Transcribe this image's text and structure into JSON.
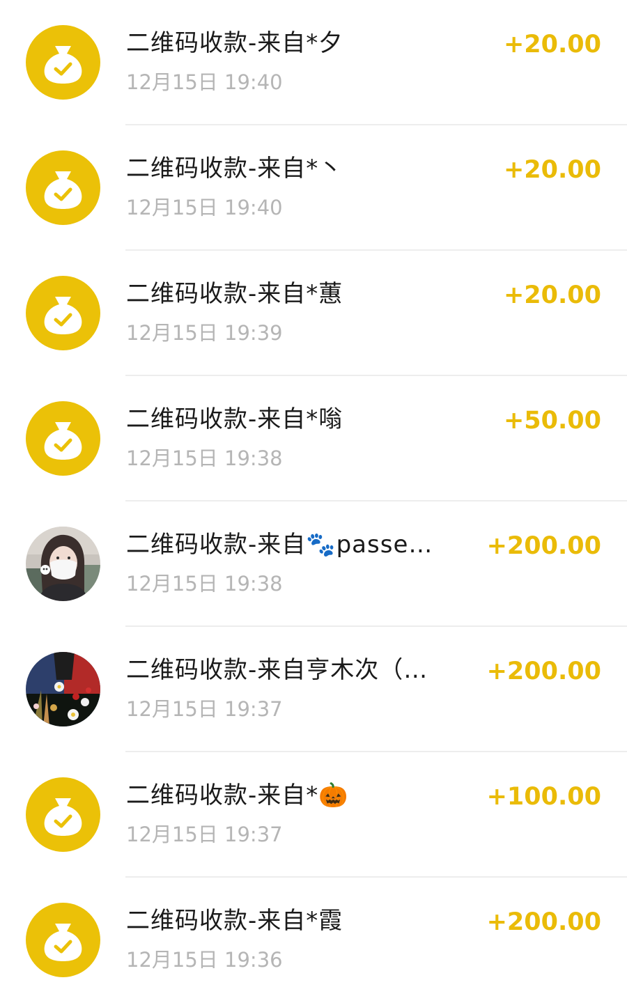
{
  "colors": {
    "accent_yellow": "#ebc108",
    "amount_color": "#eabb08",
    "title_color": "#1a1a1a",
    "time_color": "#b5b5b5",
    "divider": "#ededed"
  },
  "transactions": [
    {
      "title": "二维码收款-来自*夕",
      "time": "12月15日 19:40",
      "amount": "+20.00",
      "avatar": "money-bag-icon"
    },
    {
      "title": "二维码收款-来自*丶",
      "time": "12月15日 19:40",
      "amount": "+20.00",
      "avatar": "money-bag-icon"
    },
    {
      "title": "二维码收款-来自*蕙",
      "time": "12月15日 19:39",
      "amount": "+20.00",
      "avatar": "money-bag-icon"
    },
    {
      "title": "二维码收款-来自*嗡",
      "time": "12月15日 19:38",
      "amount": "+50.00",
      "avatar": "money-bag-icon"
    },
    {
      "title": "二维码收款-来自🐾passe…",
      "time": "12月15日 19:38",
      "amount": "+200.00",
      "avatar": "user-photo-masked-girl"
    },
    {
      "title": "二维码收款-来自亨木次（…",
      "time": "12月15日 19:37",
      "amount": "+200.00",
      "avatar": "user-photo-flowers"
    },
    {
      "title": "二维码收款-来自*🎃",
      "time": "12月15日 19:37",
      "amount": "+100.00",
      "avatar": "money-bag-icon"
    },
    {
      "title": "二维码收款-来自*霞",
      "time": "12月15日 19:36",
      "amount": "+200.00",
      "avatar": "money-bag-icon"
    }
  ]
}
